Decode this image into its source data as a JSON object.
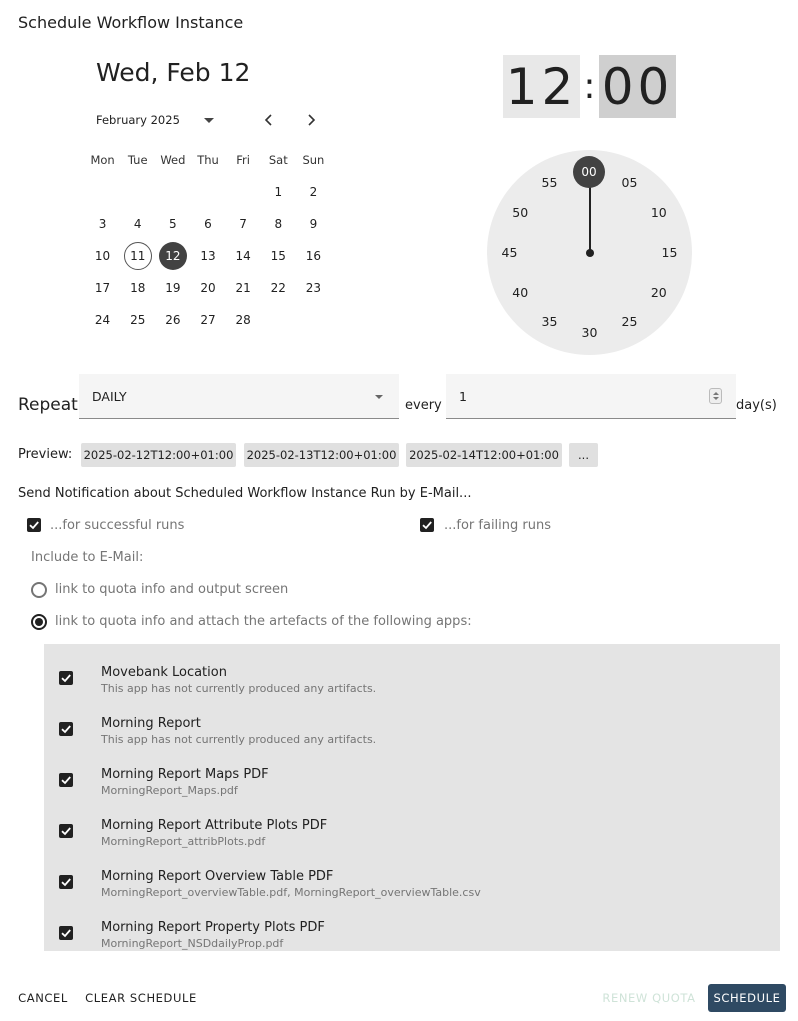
{
  "dialog": {
    "title": "Schedule Workflow Instance"
  },
  "date_picker": {
    "selected_label": "Wed, Feb 12",
    "month_label": "February 2025",
    "weekdays": [
      "Mon",
      "Tue",
      "Wed",
      "Thu",
      "Fri",
      "Sat",
      "Sun"
    ],
    "weeks": [
      [
        "",
        "",
        "",
        "",
        "",
        "1",
        "2"
      ],
      [
        "3",
        "4",
        "5",
        "6",
        "7",
        "8",
        "9"
      ],
      [
        "10",
        "11",
        "12",
        "13",
        "14",
        "15",
        "16"
      ],
      [
        "17",
        "18",
        "19",
        "20",
        "21",
        "22",
        "23"
      ],
      [
        "24",
        "25",
        "26",
        "27",
        "28",
        "",
        ""
      ]
    ],
    "today": "11",
    "selected": "12"
  },
  "time_picker": {
    "hour": "12",
    "separator": ":",
    "minute": "00",
    "clock_numbers": [
      "00",
      "05",
      "10",
      "15",
      "20",
      "25",
      "30",
      "35",
      "40",
      "45",
      "50",
      "55"
    ],
    "active_number": "00"
  },
  "repeat": {
    "label": "Repeat",
    "frequency": "DAILY",
    "every_label": "every",
    "interval": "1",
    "unit_label": "day(s)"
  },
  "preview": {
    "label": "Preview:",
    "items": [
      "2025-02-12T12:00+01:00",
      "2025-02-13T12:00+01:00",
      "2025-02-14T12:00+01:00"
    ],
    "more_label": "..."
  },
  "notification": {
    "heading": "Send Notification about Scheduled Workflow Instance Run by E-Mail...",
    "successful_label": "...for successful runs",
    "successful_checked": true,
    "failing_label": "...for failing runs",
    "failing_checked": true,
    "include_label": "Include to E-Mail:",
    "option_link_label": "link to quota info and output screen",
    "option_attach_label": "link to quota info and attach the artefacts of the following apps:",
    "selected_option": "attach"
  },
  "apps": [
    {
      "name": "Movebank Location",
      "detail": "This app has not currently produced any artifacts.",
      "checked": true
    },
    {
      "name": "Morning Report",
      "detail": "This app has not currently produced any artifacts.",
      "checked": true
    },
    {
      "name": "Morning Report Maps PDF",
      "detail": "MorningReport_Maps.pdf",
      "checked": true
    },
    {
      "name": "Morning Report Attribute Plots PDF",
      "detail": "MorningReport_attribPlots.pdf",
      "checked": true
    },
    {
      "name": "Morning Report Overview Table PDF",
      "detail": "MorningReport_overviewTable.pdf, MorningReport_overviewTable.csv",
      "checked": true
    },
    {
      "name": "Morning Report Property Plots PDF",
      "detail": "MorningReport_NSDdailyProp.pdf",
      "checked": true
    }
  ],
  "footer": {
    "cancel_label": "CANCEL",
    "clear_label": "CLEAR SCHEDULE",
    "renew_label": "RENEW QUOTA",
    "schedule_label": "SCHEDULE"
  },
  "colors": {
    "primary_button": "#2f4a63",
    "disabled_button_text": "#cfe3d8",
    "selected_day": "#424242"
  }
}
